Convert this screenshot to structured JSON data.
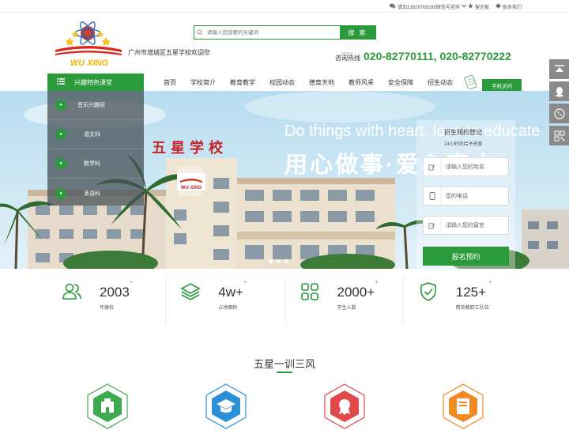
{
  "topbar": {
    "wechat": "请加13829766289微信号咨询",
    "message": "留言板",
    "contact": "联系我们"
  },
  "header": {
    "logo_text": "WU XING",
    "welcome": "广州市增城区五星学校欢迎您",
    "search_placeholder": "请输入您想要的关键词",
    "search_button": "搜 索",
    "hotline_small": "ADVICE",
    "hotline_label": "咨询热线",
    "hotline_numbers": "020-82770111, 020-82770222"
  },
  "nav": {
    "category_button": "兴趣特色课堂",
    "items": [
      "首页",
      "学校简介",
      "教育教学",
      "校园动态",
      "德育天地",
      "教师风采",
      "安全保障",
      "招生动态"
    ],
    "mobile": "手机访问"
  },
  "sidebar": {
    "items": [
      "音乐兴趣班",
      "语文科",
      "数学科",
      "英语科"
    ]
  },
  "banner": {
    "english": "Do things with heart, love to educate",
    "chinese": "用心做事·爱心育人",
    "building_sign": "五星学校",
    "building_logo": "WU XING"
  },
  "form": {
    "title": "招生预约登记",
    "subtitle": "24小时内给予答复",
    "name_placeholder": "请输入您的姓名",
    "phone_placeholder": "您的电话",
    "message_placeholder": "请输入您的留言",
    "submit": "报名预约"
  },
  "stats": [
    {
      "value": "2003",
      "plus": "+",
      "label": "年建校",
      "icon": "people-icon"
    },
    {
      "value": "4w+",
      "plus": "+",
      "label": "占地面积",
      "icon": "layers-icon"
    },
    {
      "value": "2000+",
      "plus": "+",
      "label": "学生人数",
      "icon": "grid-icon"
    },
    {
      "value": "125+",
      "plus": "+",
      "label": "精英教职工队伍",
      "icon": "shield-check-icon"
    }
  ],
  "section": {
    "title": "五星一训三风"
  },
  "colors": {
    "accent": "#2a9a3a",
    "hex_green": "#3daa4e",
    "hex_blue": "#2d8fd5",
    "hex_red": "#e04a4a",
    "hex_orange": "#f08a24"
  }
}
